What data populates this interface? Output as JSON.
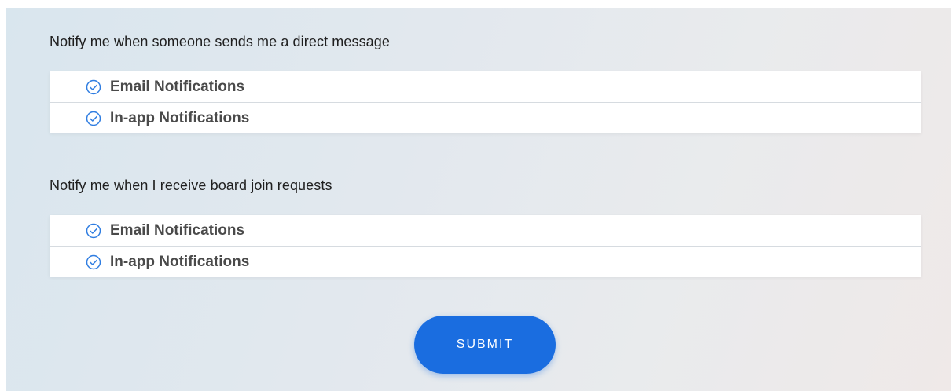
{
  "sections": [
    {
      "heading": "Notify me when someone sends me a direct message",
      "options": [
        {
          "label": "Email Notifications",
          "checked": true
        },
        {
          "label": "In-app Notifications",
          "checked": true
        }
      ]
    },
    {
      "heading": "Notify me when I receive board join requests",
      "options": [
        {
          "label": "Email Notifications",
          "checked": true
        },
        {
          "label": "In-app Notifications",
          "checked": true
        }
      ]
    }
  ],
  "submit_label": "SUBMIT",
  "colors": {
    "accent": "#1a6de0",
    "check_icon": "#2f7de1",
    "label_text": "#4a4a4a"
  },
  "icons": {
    "option_icon": "check-circle-icon"
  }
}
